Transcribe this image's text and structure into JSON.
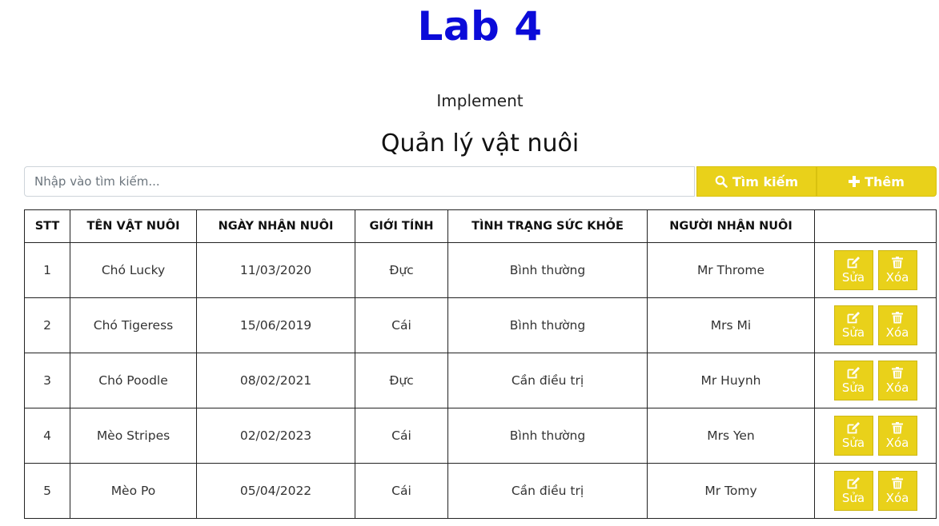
{
  "header": {
    "title": "Lab 4",
    "subtitle": "Implement"
  },
  "section": {
    "title": "Quản lý vật nuôi"
  },
  "search": {
    "placeholder": "Nhập vào tìm kiếm...",
    "value": "",
    "search_label": "Tìm kiếm",
    "add_label": "Thêm"
  },
  "table": {
    "columns": [
      "STT",
      "TÊN VẬT NUÔI",
      "NGÀY NHẬN NUÔI",
      "GIỚI TÍNH",
      "TÌNH TRẠNG SỨC KHỎE",
      "NGƯỜI NHẬN NUÔI",
      ""
    ],
    "edit_label": "Sửa",
    "delete_label": "Xóa",
    "rows": [
      [
        "1",
        "Chó Lucky",
        "11/03/2020",
        "Đực",
        "Bình thường",
        "Mr Throme"
      ],
      [
        "2",
        "Chó Tigeress",
        "15/06/2019",
        "Cái",
        "Bình thường",
        "Mrs Mi"
      ],
      [
        "3",
        "Chó Poodle",
        "08/02/2021",
        "Đực",
        "Cần điều trị",
        "Mr Huynh"
      ],
      [
        "4",
        "Mèo Stripes",
        "02/02/2023",
        "Cái",
        "Bình thường",
        "Mrs Yen"
      ],
      [
        "5",
        "Mèo Po",
        "05/04/2022",
        "Cái",
        "Cần điều trị",
        "Mr Tomy"
      ]
    ]
  },
  "colors": {
    "title": "#0b0bd9",
    "accent": "#e9d11a",
    "border": "#222222"
  },
  "icons": {
    "search": "search-icon",
    "add": "plus-icon",
    "edit": "edit-icon",
    "delete": "trash-icon"
  }
}
